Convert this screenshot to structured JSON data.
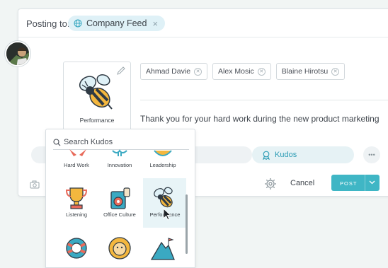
{
  "posting": {
    "label": "Posting to:",
    "feed": "Company Feed",
    "feed_remove": "×"
  },
  "kudo": {
    "selected_label": "Performance"
  },
  "recipients": [
    {
      "name": "Ahmad Davie"
    },
    {
      "name": "Alex Mosic"
    },
    {
      "name": "Blaine Hirotsu"
    }
  ],
  "message": "Thank you for your hard work during the new product marketing campaign!",
  "actions": {
    "kudos_label": "Kudos",
    "more": "•••"
  },
  "footer": {
    "cancel": "Cancel",
    "post": "POST"
  },
  "picker": {
    "search_placeholder": "Search Kudos",
    "items": [
      {
        "label": "Hard Work"
      },
      {
        "label": "Innovation"
      },
      {
        "label": "Leadership"
      },
      {
        "label": "Listening"
      },
      {
        "label": "Office Culture"
      },
      {
        "label": "Performance"
      },
      {
        "label": ""
      },
      {
        "label": ""
      },
      {
        "label": ""
      }
    ]
  },
  "colors": {
    "accent": "#3fb6c5",
    "kudos_text": "#2a9bb4",
    "pill_bg": "#dff1f7",
    "bee_yellow": "#f4b73e"
  }
}
